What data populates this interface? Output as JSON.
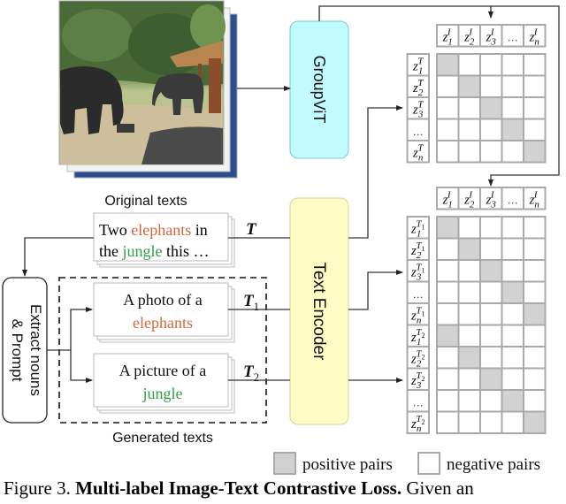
{
  "figure": {
    "labels": {
      "original_texts": "Original texts",
      "generated_texts": "Generated texts",
      "groupvit": "GroupViT",
      "text_encoder": "Text Encoder",
      "extract_line1": "Extract nouns",
      "extract_line2": "& Prompt"
    },
    "image_stack": {
      "description": "photo of two elephants near a thatched hut in a jungle clearing",
      "stack_count": 3
    },
    "original_text": {
      "line1": [
        {
          "text": "Two ",
          "color": "#000000"
        },
        {
          "text": "elephants",
          "color": "#d0683a"
        },
        {
          "text": " in",
          "color": "#000000"
        }
      ],
      "line2": [
        {
          "text": "the ",
          "color": "#000000"
        },
        {
          "text": "jungle",
          "color": "#2ea043"
        },
        {
          "text": " this …",
          "color": "#000000"
        }
      ],
      "symbol": "T"
    },
    "generated": [
      {
        "line1": "A photo of a",
        "line2": "elephants",
        "line2_color": "#d0683a",
        "symbol": "T",
        "sub": "1"
      },
      {
        "line1": "A picture of a",
        "line2": "jungle",
        "line2_color": "#2ea043",
        "symbol": "T",
        "sub": "2"
      }
    ],
    "matrix_top": {
      "col_headers": [
        {
          "sup": "I",
          "sub": "1"
        },
        {
          "sup": "I",
          "sub": "2"
        },
        {
          "sup": "I",
          "sub": "3"
        },
        {
          "dots": "…"
        },
        {
          "sup": "I",
          "sub": "n"
        }
      ],
      "row_headers": [
        {
          "sup": "T",
          "sub": "1"
        },
        {
          "sup": "T",
          "sub": "2"
        },
        {
          "sup": "T",
          "sub": "3"
        },
        {
          "dots": "…"
        },
        {
          "sup": "T",
          "sub": "n"
        }
      ],
      "positive_cells": [
        [
          0,
          0
        ],
        [
          1,
          1
        ],
        [
          2,
          2
        ],
        [
          3,
          3
        ],
        [
          4,
          4
        ]
      ]
    },
    "matrix_bottom": {
      "col_headers": [
        {
          "sup": "I",
          "sub": "1"
        },
        {
          "sup": "I",
          "sub": "2"
        },
        {
          "sup": "I",
          "sub": "3"
        },
        {
          "dots": "…"
        },
        {
          "sup": "I",
          "sub": "n"
        }
      ],
      "row_headers": [
        {
          "sup": "T",
          "supsub": "1",
          "sub": "1"
        },
        {
          "sup": "T",
          "supsub": "1",
          "sub": "2"
        },
        {
          "sup": "T",
          "supsub": "1",
          "sub": "3"
        },
        {
          "dots": "…"
        },
        {
          "sup": "T",
          "supsub": "1",
          "sub": "n"
        },
        {
          "sup": "T",
          "supsub": "2",
          "sub": "1"
        },
        {
          "sup": "T",
          "supsub": "2",
          "sub": "2"
        },
        {
          "sup": "T",
          "supsub": "2",
          "sub": "3"
        },
        {
          "dots": "…"
        },
        {
          "sup": "T",
          "supsub": "2",
          "sub": "n"
        }
      ],
      "positive_cells": [
        [
          0,
          0
        ],
        [
          1,
          1
        ],
        [
          2,
          2
        ],
        [
          3,
          3
        ],
        [
          4,
          4
        ],
        [
          5,
          0
        ],
        [
          6,
          1
        ],
        [
          7,
          2
        ],
        [
          8,
          3
        ],
        [
          9,
          4
        ]
      ]
    },
    "legend": {
      "positive": "positive pairs",
      "negative": "negative pairs"
    },
    "colors": {
      "groupvit_fill": "#c2fbff",
      "groupvit_stroke": "#7fc8cc",
      "text_encoder_fill": "#fdfcc4",
      "text_encoder_stroke": "#d6d29a",
      "positive_fill": "#d2d2d2",
      "cell_stroke": "#a9a9a9",
      "line": "#333333"
    }
  },
  "caption": {
    "prefix": "Figure 3.  ",
    "bold": "Multi-label Image-Text Contrastive Loss.",
    "rest": "  Given an"
  }
}
